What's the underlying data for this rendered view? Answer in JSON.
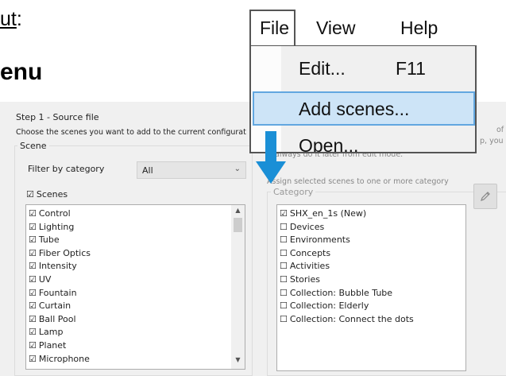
{
  "heading": {
    "line1_underlined": "ut",
    "line1_after": ":",
    "line2": "enu"
  },
  "dialog": {
    "step_title": "Step 1 - Source file",
    "step_description": "Choose the scenes you want to add to the current configuration",
    "right_note_1": "of",
    "right_note_2": "p, you",
    "right_note_3": "always do it later from edit mode.",
    "assign_note": "Assign selected scenes to one or more category",
    "scene_group": {
      "legend": "Scene",
      "filter_label": "Filter by category",
      "filter_value": "All",
      "scenes_all_label": "Scenes",
      "scenes": [
        "Control",
        "Lighting",
        "Tube",
        "Fiber Optics",
        "Intensity",
        "UV",
        "Fountain",
        "Curtain",
        "Ball Pool",
        "Lamp",
        "Planet",
        "Microphone"
      ]
    },
    "category_group": {
      "legend": "Category",
      "items": [
        {
          "label": "SHX_en_1s (New)",
          "checked": true
        },
        {
          "label": "Devices",
          "checked": false
        },
        {
          "label": "Environments",
          "checked": false
        },
        {
          "label": "Concepts",
          "checked": false
        },
        {
          "label": "Activities",
          "checked": false
        },
        {
          "label": "Stories",
          "checked": false
        },
        {
          "label": "Collection: Bubble Tube",
          "checked": false
        },
        {
          "label": "Collection: Elderly",
          "checked": false
        },
        {
          "label": "Collection: Connect the dots",
          "checked": false
        }
      ]
    }
  },
  "menu": {
    "bar": [
      "File",
      "View",
      "Help"
    ],
    "file_items": [
      {
        "label": "Edit...",
        "shortcut": "F11"
      },
      {
        "label": "Add scenes...",
        "shortcut": "",
        "highlighted": true
      },
      {
        "label": "Open...",
        "shortcut": ""
      }
    ]
  },
  "colors": {
    "highlight_fill": "#cde4f7",
    "highlight_border": "#62a7e0",
    "arrow": "#1a8fd6",
    "dialog_bg": "#f0f0f0"
  },
  "icons": {
    "pencil": "pencil-icon",
    "arrow": "arrow-down-icon",
    "chevron": "chevron-down-icon"
  }
}
